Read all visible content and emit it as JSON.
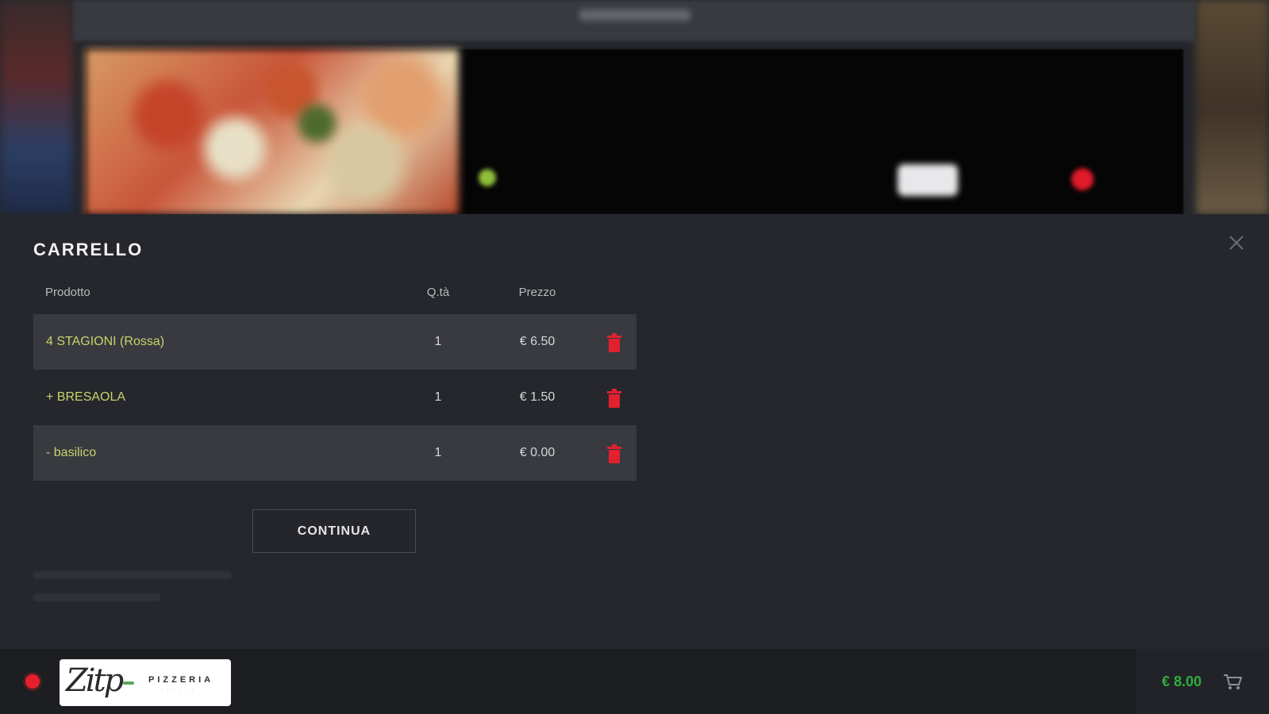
{
  "cart": {
    "title": "CARRELLO",
    "columns": {
      "product": "Prodotto",
      "qty": "Q.tà",
      "price": "Prezzo"
    },
    "items": [
      {
        "name": "4 STAGIONI (Rossa)",
        "qty": "1",
        "price": "€ 6.50"
      },
      {
        "name": "+ BRESAOLA",
        "qty": "1",
        "price": "€ 1.50"
      },
      {
        "name": "- basilico",
        "qty": "1",
        "price": "€ 0.00"
      }
    ],
    "continue_label": "CONTINUA"
  },
  "bottom_bar": {
    "total": "€ 8.00"
  },
  "icons": {
    "close": "close-icon",
    "trash": "trash-icon",
    "cart": "cart-icon"
  },
  "colors": {
    "accent_green": "#2fae3e",
    "item_text": "#c9d36a",
    "delete_red": "#e2202e"
  }
}
